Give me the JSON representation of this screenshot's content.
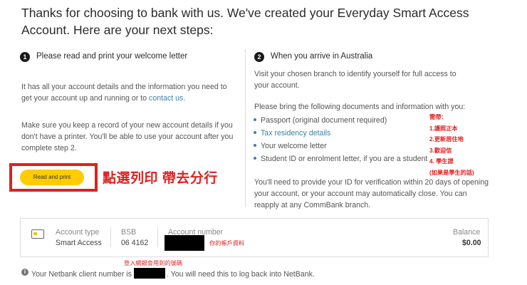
{
  "heading": "Thanks for choosing to bank with us. We've created your Everyday Smart Access Account. Here are your next steps:",
  "step1": {
    "number": "1",
    "title": "Please read and print your welcome letter",
    "para1_pre": "It has all your account details and the information you need to get your account up and running or to ",
    "para1_link": "contact us",
    "para1_post": ".",
    "para2": "Make sure you keep a record of your new account details if you don't have a printer. You'll be able to use your account after you complete step 2.",
    "button_label": "Read and print"
  },
  "annotation_print": "點選列印 帶去分行",
  "step2": {
    "number": "2",
    "title": "When you arrive in Australia",
    "para1": "Visit your chosen branch to identify yourself for full access to your account.",
    "para2": "Please bring the following documents and information with you:",
    "bullets": [
      {
        "text": "Passport (original document required)",
        "link": false
      },
      {
        "text": "Tax residency details",
        "link": true
      },
      {
        "text": "Your welcome letter",
        "link": false
      },
      {
        "text": "Student ID or enrolment letter, if you are a student",
        "link": false
      }
    ],
    "para3": "You'll need to provide your ID for verification within 20 days of opening your account, or your account may automatically close. You can reapply at any CommBank branch."
  },
  "annotation_list": {
    "header": "需帶：",
    "items": [
      "1.護照正本",
      "2.更新居住地",
      "3.歡迎信",
      "4. 學生證",
      "(如果是學生的話)"
    ]
  },
  "account": {
    "type_label": "Account type",
    "type_value": "Smart Access",
    "bsb_label": "BSB",
    "bsb_value": "06 4162",
    "number_label": "Account number",
    "number_annotation": "你的帳戶資料",
    "balance_label": "Balance",
    "balance_value": "$0.00"
  },
  "login_annotation": "登入網銀會用到的號碼",
  "netbank": {
    "info_glyph": "i",
    "pre": "Your Netbank client number is",
    "post": ". You will need this to log back into NetBank."
  },
  "colors": {
    "accent_yellow": "#ffcc00",
    "annotation_red": "#e02020",
    "link_blue": "#3b82a6"
  }
}
